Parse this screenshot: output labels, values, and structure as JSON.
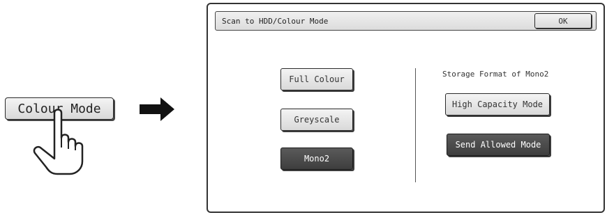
{
  "colour_mode_button": {
    "label": "Colour Mode"
  },
  "dialog": {
    "title": "Scan to HDD/Colour Mode",
    "ok_label": "OK",
    "colour_options": [
      {
        "label": "Full Colour",
        "selected": false
      },
      {
        "label": "Greyscale",
        "selected": false
      },
      {
        "label": "Mono2",
        "selected": true
      }
    ],
    "storage_format": {
      "heading": "Storage Format of Mono2",
      "options": [
        {
          "label": "High Capacity Mode",
          "selected": false
        },
        {
          "label": "Send Allowed Mode",
          "selected": true
        }
      ]
    }
  },
  "icons": [
    "pointing-hand-icon",
    "right-arrow-icon"
  ],
  "colors": {
    "selected_button": "#4a4a4a",
    "button_face": "#e4e4e4",
    "border": "#2a2a2a"
  }
}
